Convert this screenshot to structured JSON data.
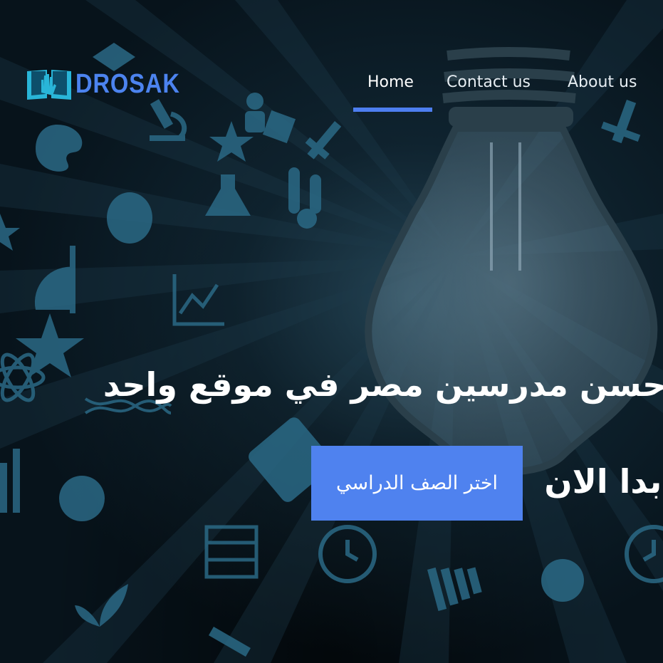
{
  "brand": {
    "name": "DROSAK",
    "logo_icon": "open-book-hand-icon",
    "accent_color": "#4c83ef"
  },
  "nav": {
    "items": [
      {
        "label": "Home",
        "active": true
      },
      {
        "label": "Contact us",
        "active": false
      },
      {
        "label": "About us",
        "active": false
      }
    ],
    "active_color": "#4d7ef0"
  },
  "hero": {
    "title": "احسن مدرسين مصر في موقع واحد",
    "subtitle": "ابدا الان",
    "cta_label": "اختر الصف الدراسي",
    "cta_color": "#4f82ef",
    "background": "education-doodles-lightbulb"
  }
}
